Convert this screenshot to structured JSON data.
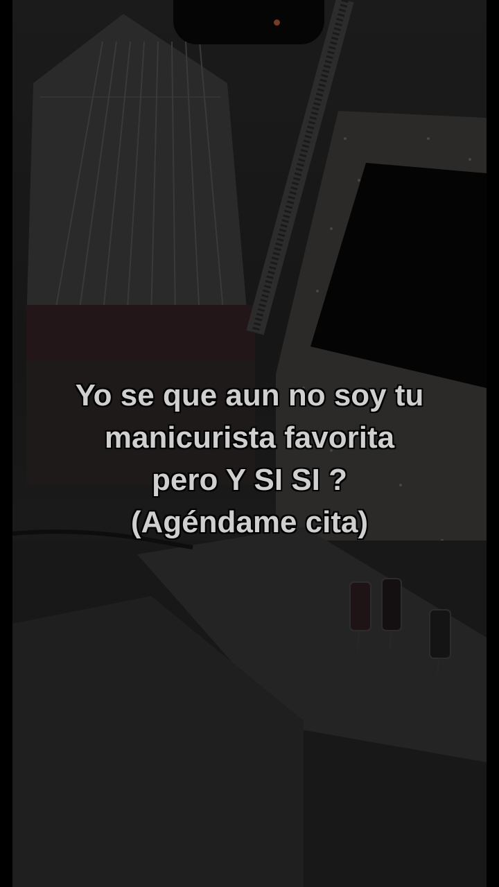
{
  "caption": {
    "line1": "Yo se que aun no soy tu",
    "line2": "manicurista favorita",
    "line3": "pero Y SI SI ?",
    "line4": "(Agéndame cita)"
  },
  "colors": {
    "background": "#000000",
    "text": "#cfcfcf",
    "photo_tint": "#1a1a1a"
  }
}
